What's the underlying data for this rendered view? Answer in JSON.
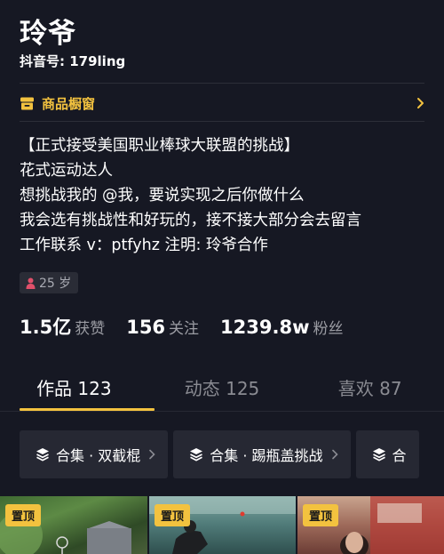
{
  "profile": {
    "name": "玲爷",
    "douyin_id": "抖音号: 179ling"
  },
  "shop": {
    "label": "商品橱窗",
    "icon": "shop-window-icon"
  },
  "bio": [
    "【正式接受美国职业棒球大联盟的挑战】",
    "花式运动达人",
    "想挑战我的 @我，要说实现之后你做什么",
    "我会选有挑战性和好玩的，接不接大部分会去留言",
    "工作联系 v：ptfyhz 注明: 玲爷合作"
  ],
  "age_tag": "25 岁",
  "stats": {
    "likes_num": "1.5亿",
    "likes_label": "获赞",
    "following_num": "156",
    "following_label": "关注",
    "followers_num": "1239.8w",
    "followers_label": "粉丝"
  },
  "tabs": [
    {
      "label": "作品 123",
      "active": true
    },
    {
      "label": "动态 125",
      "active": false
    },
    {
      "label": "喜欢 87",
      "active": false
    }
  ],
  "collections": [
    {
      "label": "合集 · 双截棍"
    },
    {
      "label": "合集 · 踢瓶盖挑战"
    },
    {
      "label": "合"
    }
  ],
  "videos": [
    {
      "badge": "置顶"
    },
    {
      "badge": "置顶"
    },
    {
      "badge": "置顶"
    }
  ],
  "colors": {
    "background": "#161823",
    "accent": "#f3c23f",
    "secondary_text": "#9b9ca3"
  }
}
